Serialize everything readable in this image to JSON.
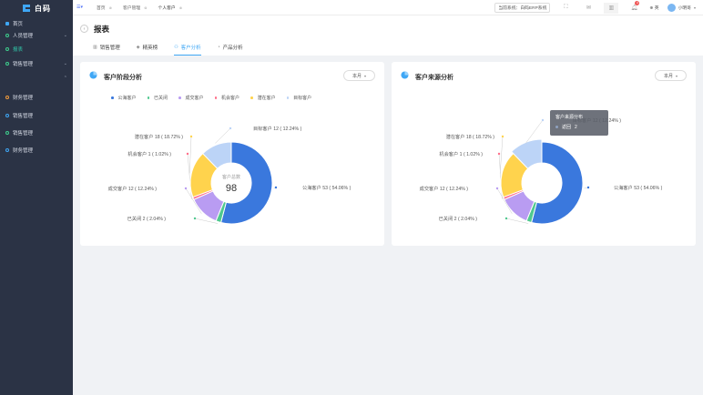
{
  "app": {
    "logo_text": "白码"
  },
  "sidebar": {
    "items": [
      {
        "label": "首页",
        "icon": "home-grid-icon",
        "arrow": ""
      },
      {
        "label": "人员管理",
        "icon": "person-icon",
        "arrow": "⌄"
      },
      {
        "label": "报表",
        "icon": "report-icon",
        "arrow": ""
      },
      {
        "label": "销售管理",
        "icon": "sales-icon",
        "arrow": "⌄"
      },
      {
        "label": "",
        "icon": "",
        "arrow": "⌃"
      },
      {
        "label": "财务管理",
        "icon": "finance-icon",
        "arrow": ""
      },
      {
        "label": "销售管理",
        "icon": "sales-icon",
        "arrow": ""
      },
      {
        "label": "销售管理",
        "icon": "sales-icon",
        "arrow": ""
      },
      {
        "label": "财务管理",
        "icon": "finance-icon",
        "arrow": ""
      }
    ]
  },
  "topbar": {
    "tabs": [
      {
        "label": "首页",
        "close": "⊗"
      },
      {
        "label": "客户管理",
        "close": "⊗"
      },
      {
        "label": "个人客户",
        "close": "⊗"
      }
    ],
    "system_label": "当前系统：白码ERP系统",
    "notification_count": "4",
    "language": "英",
    "username": "小明哥"
  },
  "page": {
    "title": "报表",
    "tabs": [
      {
        "label": "销售管理",
        "icon": "bar-chart-icon"
      },
      {
        "label": "精英榜",
        "icon": "layers-icon"
      },
      {
        "label": "客户分析",
        "icon": "users-icon",
        "active": true
      },
      {
        "label": "产品分析",
        "icon": "pie-icon"
      }
    ]
  },
  "cards": [
    {
      "title": "客户阶段分析",
      "period": "本月",
      "center_label": "客户总数",
      "center_value": "98"
    },
    {
      "title": "客户来源分析",
      "period": "本月"
    }
  ],
  "tooltip": {
    "title": "客户来源分布",
    "item_label": "返回",
    "item_value": "2"
  },
  "chart_data": [
    {
      "type": "pie",
      "title": "客户阶段分析",
      "categories": [
        "公海客户",
        "已关闭",
        "成交客户",
        "机会客户",
        "潜在客户",
        "目标客户"
      ],
      "values": [
        53,
        2,
        12,
        1,
        18,
        12
      ],
      "percents": [
        "54.06%",
        "2.04%",
        "12.24%",
        "1.02%",
        "18.72%",
        "12.24%"
      ],
      "colors": [
        "#3a78dd",
        "#4fc98f",
        "#b99cf2",
        "#ff6f8a",
        "#ffd34d",
        "#bcd4f7"
      ],
      "total": 98,
      "legend_position": "top"
    },
    {
      "type": "pie",
      "title": "客户来源分析",
      "categories": [
        "公海客户",
        "已关闭",
        "成交客户",
        "机会客户",
        "潜在客户",
        "目标客户"
      ],
      "values": [
        53,
        2,
        12,
        1,
        18,
        12
      ],
      "percents": [
        "54.06%",
        "2.04%",
        "12.24%",
        "1.02%",
        "18.72%",
        "12.24%"
      ],
      "colors": [
        "#3a78dd",
        "#4fc98f",
        "#b99cf2",
        "#ff6f8a",
        "#ffd34d",
        "#bcd4f7"
      ]
    }
  ]
}
